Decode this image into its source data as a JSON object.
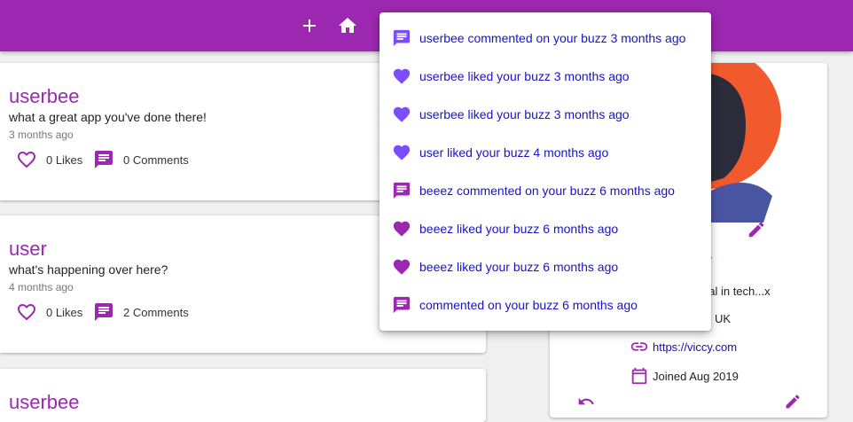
{
  "colors": {
    "appbar": "#9c27b0",
    "accent": "#9c27b0",
    "link": "#1a13c4",
    "unread_icon": "#7c4dff",
    "read_icon": "#9c27b0"
  },
  "appbar": {
    "icons": [
      "plus-icon",
      "home-icon",
      "notifications-icon"
    ]
  },
  "feed": [
    {
      "username": "userbee",
      "body": "what a great app you've done there!",
      "time": "3 months ago",
      "likes": "0 Likes",
      "comments": "0 Comments"
    },
    {
      "username": "user",
      "body": "what's happening over here?",
      "time": "4 months ago",
      "likes": "0 Likes",
      "comments": "2 Comments"
    },
    {
      "username": "userbee",
      "body": "",
      "time": "",
      "likes": "",
      "comments": ""
    }
  ],
  "profile": {
    "handle": "y",
    "bio": "gal in tech...x",
    "location": "UK",
    "website": "https://viccy.com",
    "joined": "Joined Aug 2019"
  },
  "notifications": [
    {
      "text": "userbee commented on your buzz 3 months ago",
      "type": "comment",
      "read": false
    },
    {
      "text": "userbee liked your buzz 3 months ago",
      "type": "like",
      "read": false
    },
    {
      "text": "userbee liked your buzz 3 months ago",
      "type": "like",
      "read": false
    },
    {
      "text": "user liked your buzz 4 months ago",
      "type": "like",
      "read": false
    },
    {
      "text": "beeez commented on your buzz 6 months ago",
      "type": "comment",
      "read": true
    },
    {
      "text": "beeez liked your buzz 6 months ago",
      "type": "like",
      "read": true
    },
    {
      "text": "beeez liked your buzz 6 months ago",
      "type": "like",
      "read": true
    },
    {
      "text": "commented on your buzz 6 months ago",
      "type": "comment",
      "read": true
    }
  ]
}
